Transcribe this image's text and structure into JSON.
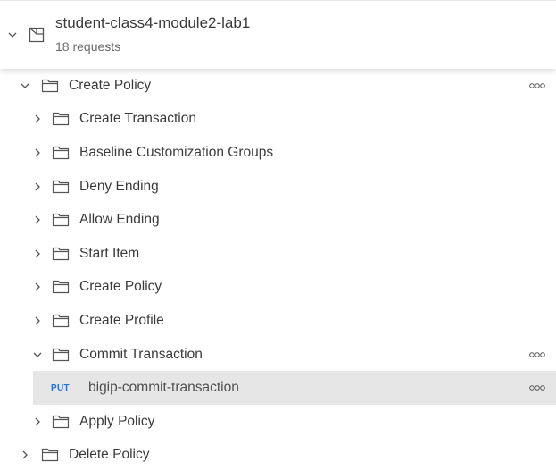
{
  "collection": {
    "name": "student-class4-module2-lab1",
    "request_count": "18 requests",
    "icons": {
      "toggle": "chevron-down-icon",
      "type": "collection-icon"
    }
  },
  "tree": {
    "root_folder": {
      "label": "Create Policy",
      "expanded": true,
      "icon": "folder-icon"
    },
    "children": [
      {
        "label": "Create Transaction",
        "expanded": false
      },
      {
        "label": "Baseline Customization Groups",
        "expanded": false
      },
      {
        "label": "Deny Ending",
        "expanded": false
      },
      {
        "label": "Allow Ending",
        "expanded": false
      },
      {
        "label": "Start Item",
        "expanded": false
      },
      {
        "label": "Create Policy",
        "expanded": false
      },
      {
        "label": "Create Profile",
        "expanded": false
      },
      {
        "label": "Commit Transaction",
        "expanded": true
      }
    ],
    "request": {
      "method": "PUT",
      "label": "bigip-commit-transaction",
      "selected": true
    },
    "after_request": [
      {
        "label": "Apply Policy",
        "expanded": false
      }
    ],
    "sibling_folder": {
      "label": "Delete Policy",
      "expanded": false
    }
  },
  "colors": {
    "method_put": "#2a6fd6",
    "selected_row": "#e6e6e6",
    "text": "#3b3b3b"
  }
}
